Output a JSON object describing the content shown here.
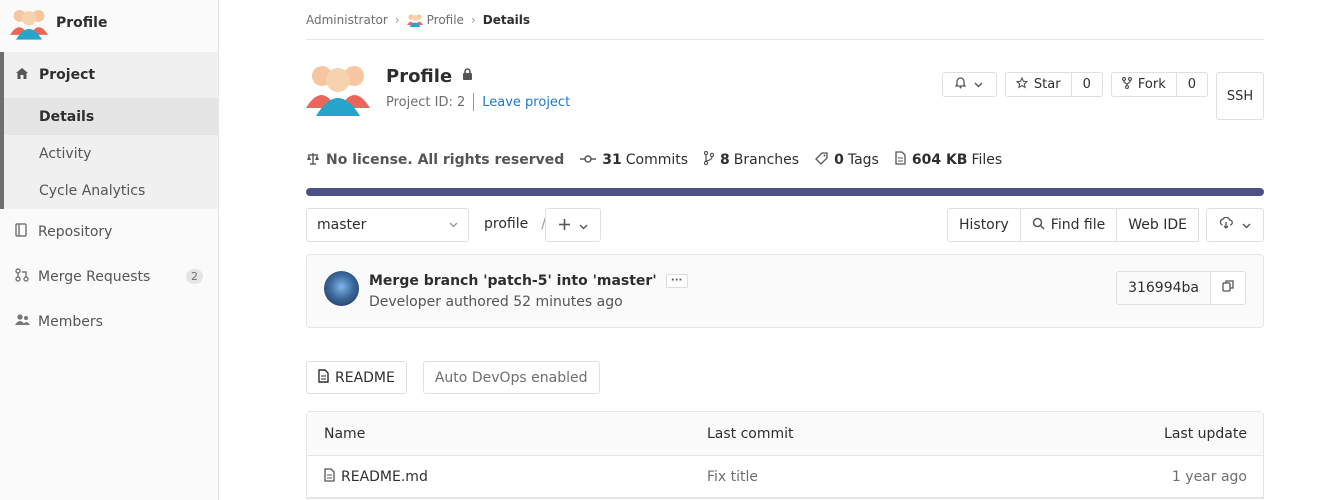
{
  "sidebar": {
    "project_name": "Profile",
    "group_label": "Project",
    "sub_items": [
      {
        "label": "Details"
      },
      {
        "label": "Activity"
      },
      {
        "label": "Cycle Analytics"
      }
    ],
    "items": [
      {
        "label": "Repository",
        "icon": "book-icon"
      },
      {
        "label": "Merge Requests",
        "icon": "merge-request-icon",
        "badge": "2"
      },
      {
        "label": "Members",
        "icon": "users-icon"
      }
    ]
  },
  "breadcrumb": {
    "root": "Administrator",
    "project": "Profile",
    "current": "Details"
  },
  "project": {
    "title": "Profile",
    "id_text": "Project ID: 2",
    "leave_link": "Leave project",
    "star_label": "Star",
    "star_count": "0",
    "fork_label": "Fork",
    "fork_count": "0",
    "ssh_label": "SSH"
  },
  "stats": {
    "license": "No license. All rights reserved",
    "commits_count": "31",
    "commits_label": "Commits",
    "branches_count": "8",
    "branches_label": "Branches",
    "tags_count": "0",
    "tags_label": "Tags",
    "files_size": "604 KB",
    "files_label": "Files"
  },
  "tree": {
    "branch": "master",
    "path": "profile",
    "path_sep": "/",
    "history_label": "History",
    "find_file_label": "Find file",
    "web_ide_label": "Web IDE"
  },
  "commit": {
    "title": "Merge branch 'patch-5' into 'master'",
    "ellipsis": "···",
    "subtitle": "Developer authored 52 minutes ago",
    "sha": "316994ba"
  },
  "readme_row": {
    "readme_label": "README",
    "devops_label": "Auto DevOps enabled"
  },
  "file_table": {
    "headers": {
      "name": "Name",
      "last_commit": "Last commit",
      "last_update": "Last update"
    },
    "rows": [
      {
        "name": "README.md",
        "last_commit": "Fix title",
        "last_update": "1 year ago"
      }
    ]
  },
  "colors": {
    "link": "#1f78d1",
    "language_bar": "#4b5186",
    "sidebar_bg": "#fafafa"
  }
}
